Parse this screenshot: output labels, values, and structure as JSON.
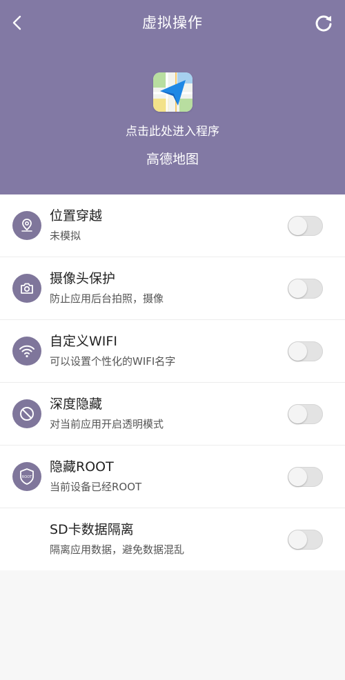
{
  "header": {
    "title": "虚拟操作",
    "enter_hint": "点击此处进入程序",
    "app_name": "高德地图",
    "background_color": "#8279a4"
  },
  "icons": {
    "back": "chevron-left-icon",
    "refresh": "refresh-icon",
    "app": "amap-app-icon"
  },
  "settings": [
    {
      "id": "location",
      "icon": "location-pin-icon",
      "title": "位置穿越",
      "subtitle": "未模拟",
      "enabled": false
    },
    {
      "id": "camera",
      "icon": "camera-icon",
      "title": "摄像头保护",
      "subtitle": "防止应用后台拍照，摄像",
      "enabled": false
    },
    {
      "id": "wifi",
      "icon": "wifi-icon",
      "title": "自定义WIFI",
      "subtitle": "可以设置个性化的WIFI名字",
      "enabled": false
    },
    {
      "id": "hide",
      "icon": "no-entry-icon",
      "title": "深度隐藏",
      "subtitle": "对当前应用开启透明模式",
      "enabled": false
    },
    {
      "id": "root",
      "icon": "root-shield-icon",
      "icon_text": "ROOT",
      "title": "隐藏ROOT",
      "subtitle": "当前设备已经ROOT",
      "enabled": false
    },
    {
      "id": "sd",
      "icon": "",
      "title": "SD卡数据隔离",
      "subtitle": "隔离应用数据，避免数据混乱",
      "enabled": false
    }
  ],
  "colors": {
    "accent": "#7f769b",
    "toggle_off": "#e3e3e3"
  }
}
